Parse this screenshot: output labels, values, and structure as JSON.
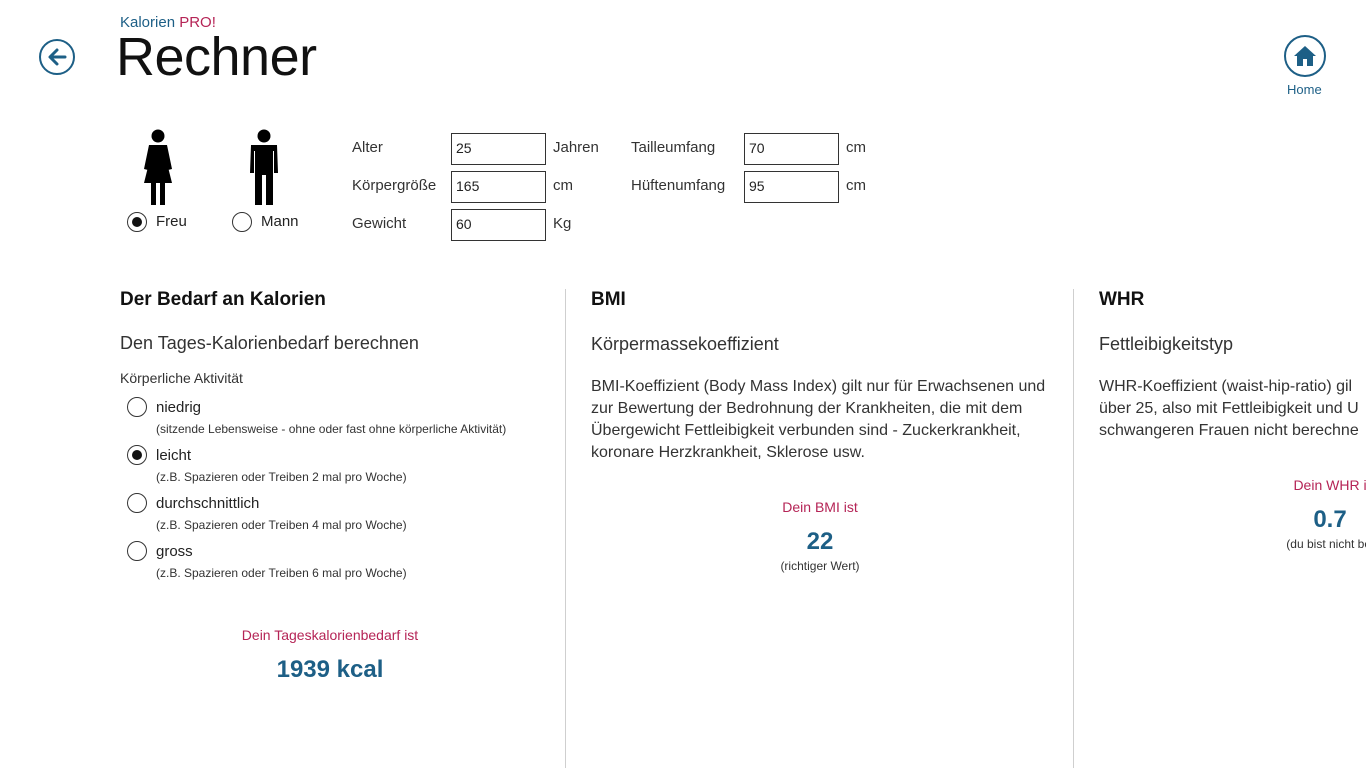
{
  "header": {
    "brand_part1": "Kalorien",
    "brand_part2": "PRO!",
    "title": "Rechner",
    "home_label": "Home"
  },
  "gender": {
    "female_label": "Freu",
    "male_label": "Mann",
    "selected": "female"
  },
  "fields": {
    "age": {
      "label": "Alter",
      "value": "25",
      "unit": "Jahren"
    },
    "height": {
      "label": "Körpergröße",
      "value": "165",
      "unit": "cm"
    },
    "weight": {
      "label": "Gewicht",
      "value": "60",
      "unit": "Kg"
    },
    "waist": {
      "label": "Tailleumfang",
      "value": "70",
      "unit": "cm"
    },
    "hip": {
      "label": "Hüftenumfang",
      "value": "95",
      "unit": "cm"
    }
  },
  "calories": {
    "title": "Der Bedarf an Kalorien",
    "subtitle": "Den Tages-Kalorienbedarf berechnen",
    "activity_label": "Körperliche Aktivität",
    "activities": [
      {
        "label": "niedrig",
        "desc": "(sitzende Lebensweise - ohne oder fast ohne körperliche Aktivität)",
        "selected": false
      },
      {
        "label": "leicht",
        "desc": "(z.B. Spazieren oder Treiben 2 mal pro Woche)",
        "selected": true
      },
      {
        "label": "durchschnittlich",
        "desc": "(z.B. Spazieren oder Treiben 4 mal pro Woche)",
        "selected": false
      },
      {
        "label": "gross",
        "desc": "(z.B. Spazieren oder Treiben 6 mal pro Woche)",
        "selected": false
      }
    ],
    "result_label": "Dein Tageskalorienbedarf ist",
    "result_value": "1939 kcal"
  },
  "bmi": {
    "title": "BMI",
    "subtitle": "Körpermassekoeffizient",
    "description": "BMI-Koeffizient (Body Mass Index) gilt nur für Erwachsenen und zur Bewertung der Bedrohnung der Krankheiten, die mit dem Übergewicht Fettleibigkeit verbunden sind - Zuckerkrankheit, koronare Herzkrankheit, Sklerose usw.",
    "result_label": "Dein BMI ist",
    "result_value": "22",
    "result_note": "(richtiger Wert)"
  },
  "whr": {
    "title": "WHR",
    "subtitle": "Fettleibigkeitstyp",
    "description": "WHR-Koeffizient (waist-hip-ratio) gil über 25, also mit Fettleibigkeit und U schwangeren Frauen nicht berechne",
    "result_label": "Dein WHR i",
    "result_value": "0.7",
    "result_note": "(du bist nicht bel"
  },
  "icons": {
    "back": "arrow-left-icon",
    "home": "home-icon",
    "female": "woman-figure-icon",
    "male": "man-figure-icon"
  },
  "colors": {
    "accent": "#1d5f86",
    "highlight": "#b52456"
  }
}
